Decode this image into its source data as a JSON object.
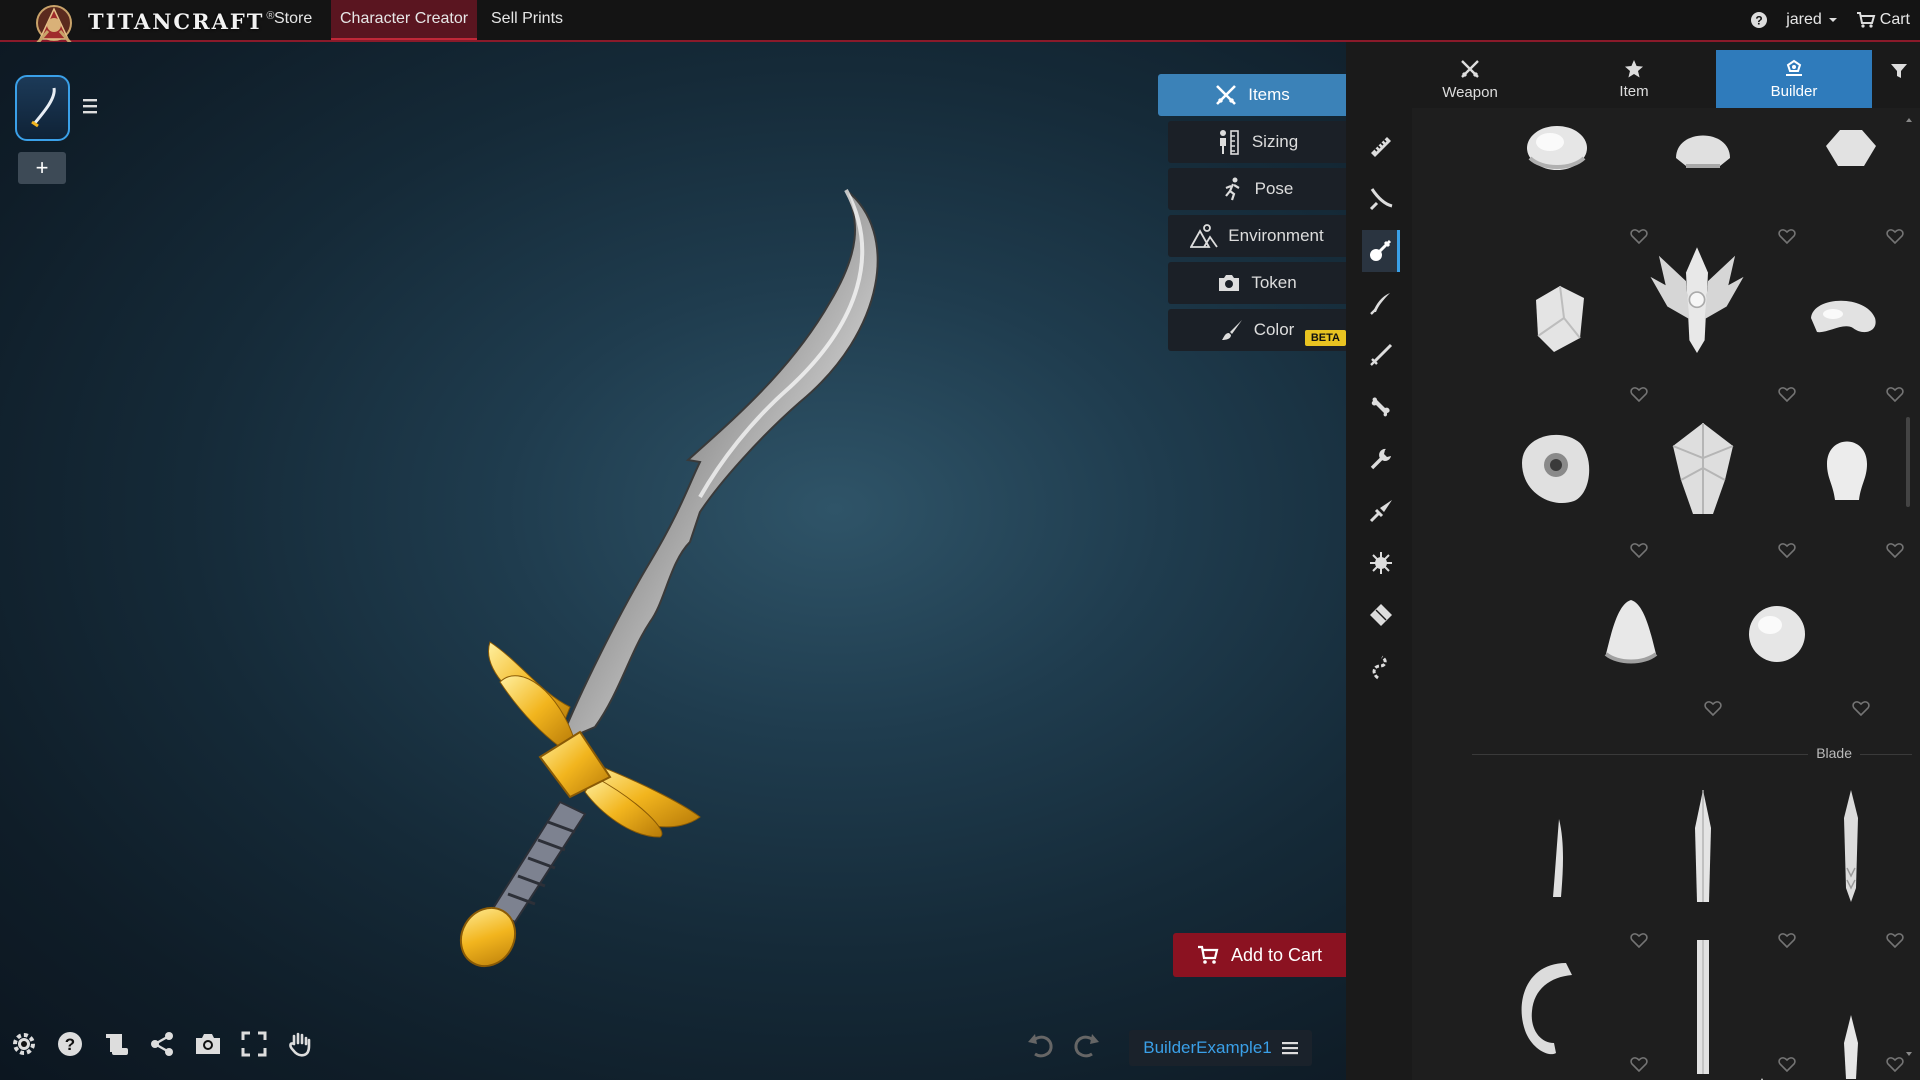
{
  "topbar": {
    "brand": "TITANCRAFT",
    "brand_mark": "®",
    "nav": [
      "Store",
      "Character Creator",
      "Sell Prints"
    ],
    "active_nav": "Character Creator",
    "help_icon": "question-circle-icon",
    "user": "jared",
    "cart_label": "Cart"
  },
  "side_menu": {
    "items": [
      {
        "label": "Items",
        "icon": "crossed-swords-icon",
        "active": true
      },
      {
        "label": "Sizing",
        "icon": "ruler-figure-icon"
      },
      {
        "label": "Pose",
        "icon": "running-figure-icon"
      },
      {
        "label": "Environment",
        "icon": "mountain-icon"
      },
      {
        "label": "Token",
        "icon": "camera-icon"
      },
      {
        "label": "Color",
        "icon": "paintbrush-icon",
        "badge": "BETA"
      }
    ]
  },
  "actions": {
    "add_to_cart": "Add to Cart",
    "scene_name": "BuilderExample1"
  },
  "right_panel": {
    "tabs": [
      {
        "label": "Weapon",
        "icon": "crossed-swords-icon"
      },
      {
        "label": "Item",
        "icon": "star-icon"
      },
      {
        "label": "Builder",
        "icon": "builder-parts-icon",
        "active": true
      }
    ],
    "section_label": "Blade"
  },
  "colors": {
    "accent_blue": "#3aa0e8",
    "tab_active": "#2f7bbb",
    "brand_red": "#8b1221",
    "beta_yellow": "#e8c321"
  }
}
